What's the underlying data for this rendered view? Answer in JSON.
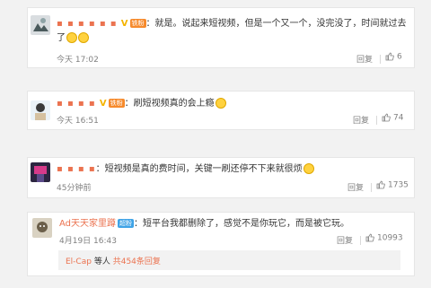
{
  "comments": [
    {
      "name": "▪ ▪ ▪ ▪ ▪ ▪",
      "level_badge": "铁粉",
      "text": "就是。说起来短视频，但是一个又一个，没完没了，时间就过去了",
      "time": "今天 17:02",
      "reply_label": "回复",
      "likes": "6"
    },
    {
      "name": "▪ ▪ ▪ ▪",
      "level_badge": "铁粉",
      "text": "刷短视频真的会上瘾",
      "time": "今天 16:51",
      "reply_label": "回复",
      "likes": "74"
    },
    {
      "name": "▪ ▪ ▪ ▪",
      "text": "短视频是真的费时间，关键一刷还停不下来就很烦",
      "time": "45分钟前",
      "reply_label": "回复",
      "likes": "1735"
    },
    {
      "name": "Ad天天家里蹲",
      "vip_badge": "超粉",
      "text": "短平台我都删除了，感觉不是你玩它，而是被它玩。",
      "time": "4月19日 16:43",
      "reply_label": "回复",
      "likes": "10993"
    }
  ],
  "replies_footer": {
    "user": "El-Cap",
    "middle": "等人",
    "link": "共454条回复"
  },
  "colors": {
    "accent": "#eb7350",
    "badge": "#f68a2c",
    "vip": "#3fa3e6"
  },
  "icons": {
    "like": "thumbs-up-icon",
    "verified": "verified-v-icon",
    "emoji": "emoji-icon"
  }
}
